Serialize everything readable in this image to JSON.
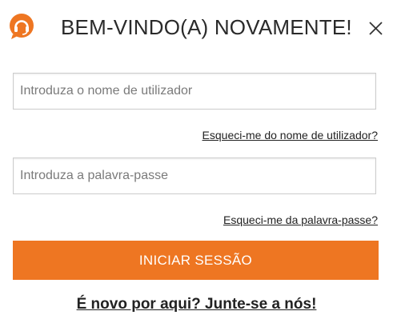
{
  "header": {
    "title": "BEM-VINDO(A) NOVAMENTE!",
    "logo_icon": "headset-chat-bubble-icon",
    "close_icon": "close-icon"
  },
  "form": {
    "username_placeholder": "Introduza o nome de utilizador",
    "username_value": "",
    "forgot_username": "Esqueci-me do nome de utilizador?",
    "password_placeholder": "Introduza a palavra-passe",
    "password_value": "",
    "forgot_password": "Esqueci-me da palavra-passe?",
    "submit_label": "INICIAR SESSÃO",
    "signup_link": "É novo por aqui? Junte-se a nós!"
  },
  "colors": {
    "accent": "#ee7622",
    "text": "#222222",
    "border": "#cccccc",
    "background": "#ffffff"
  }
}
